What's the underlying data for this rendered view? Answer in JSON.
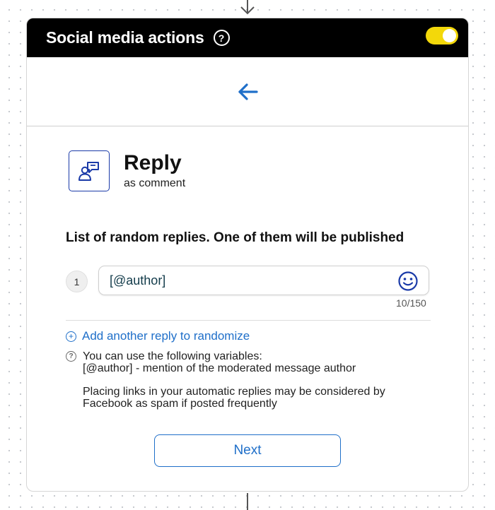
{
  "header": {
    "title": "Social media actions",
    "help_glyph": "?",
    "toggle_on": true,
    "toggle_color": "#f3d80a"
  },
  "back_icon": "arrow-left-icon",
  "action": {
    "icon": "reply-comment-icon",
    "title": "Reply",
    "subtitle": "as comment"
  },
  "replies": {
    "title": "List of random replies. One of them will be published",
    "items": [
      {
        "number": "1",
        "text": "[@author]",
        "counter": "10/150"
      }
    ],
    "add_label": "Add another reply to randomize"
  },
  "info": {
    "line1": "You can use the following variables:",
    "line2": "[@author] - mention of the moderated message author",
    "line3": "Placing links in your automatic replies may be considered by",
    "line4": "Facebook as spam if posted frequently"
  },
  "next_label": "Next",
  "accent_color": "#1f6fc9"
}
